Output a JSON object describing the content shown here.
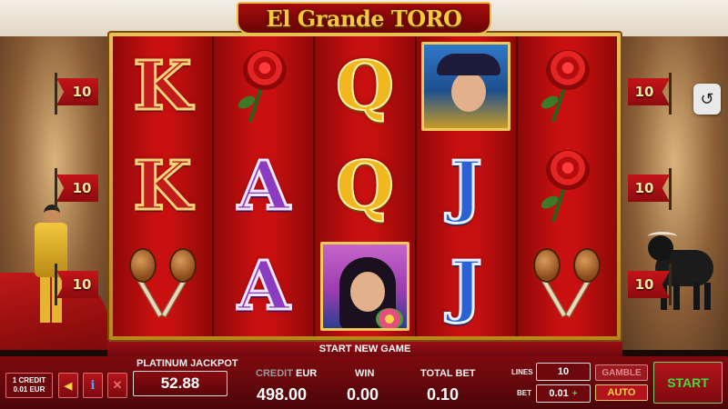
{
  "game": {
    "title": "El Grande TORO",
    "status_message": "START NEW GAME"
  },
  "reels": [
    [
      "K",
      "K",
      "maracas"
    ],
    [
      "rose",
      "A",
      "A"
    ],
    [
      "Q",
      "Q",
      "woman-portrait"
    ],
    [
      "man-portrait",
      "J",
      "J"
    ],
    [
      "rose",
      "rose",
      "maracas"
    ]
  ],
  "line_markers": {
    "left": [
      "10",
      "10",
      "10"
    ],
    "right": [
      "10",
      "10",
      "10"
    ]
  },
  "bottom_bar": {
    "credit_denom_line1": "1 CREDIT",
    "credit_denom_line2": "0.01 EUR",
    "jackpot_label": "PLATINUM JACKPOT",
    "jackpot_value": "52.88",
    "credit_label": "CREDIT",
    "credit_currency": "EUR",
    "credit_value": "498.00",
    "win_label": "WIN",
    "win_value": "0.00",
    "total_bet_label": "TOTAL BET",
    "total_bet_value": "0.10",
    "lines_label": "LINES",
    "lines_value": "10",
    "bet_label": "BET",
    "bet_value": "0.01",
    "gamble_label": "GAMBLE",
    "auto_label": "AUTO",
    "start_label": "START"
  },
  "icons": {
    "history": "history-icon",
    "back": "back-arrow-icon",
    "info": "info-icon",
    "close": "close-icon"
  },
  "colors": {
    "reel_red": "#c81010",
    "gold_frame": "#e8c15a",
    "start_green": "#3fdc3f",
    "auto_yellow": "#ffd34a"
  }
}
